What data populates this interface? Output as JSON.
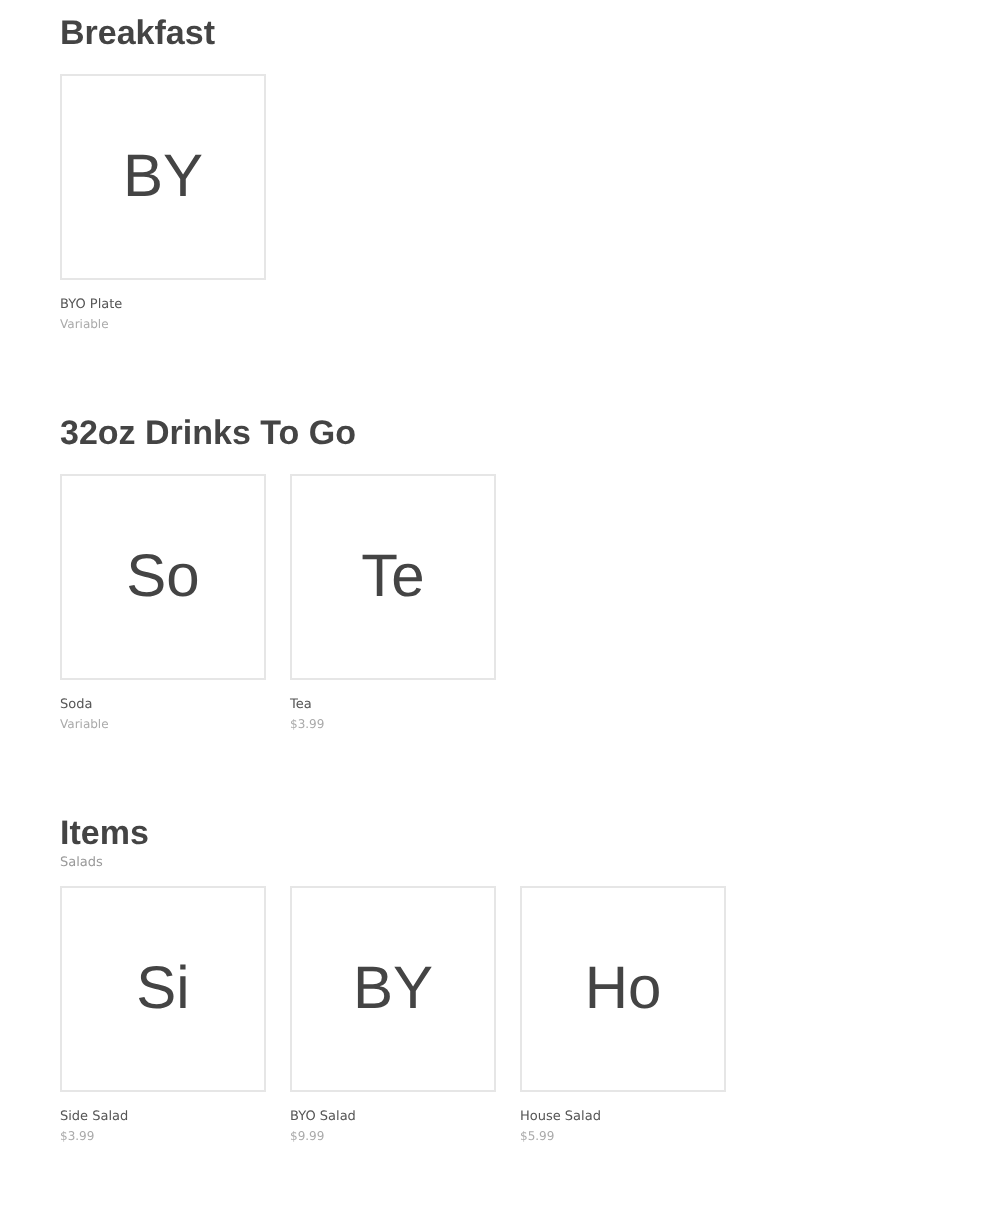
{
  "sections": [
    {
      "title": "Breakfast",
      "items": [
        {
          "initials": "BY",
          "name": "BYO Plate",
          "price": "Variable"
        }
      ]
    },
    {
      "title": "32oz Drinks To Go",
      "items": [
        {
          "initials": "So",
          "name": "Soda",
          "price": "Variable"
        },
        {
          "initials": "Te",
          "name": "Tea",
          "price": "$3.99"
        }
      ]
    },
    {
      "title": "Items",
      "subtitle": "Salads",
      "items": [
        {
          "initials": "Si",
          "name": "Side Salad",
          "price": "$3.99"
        },
        {
          "initials": "BY",
          "name": "BYO Salad",
          "price": "$9.99"
        },
        {
          "initials": "Ho",
          "name": "House Salad",
          "price": "$5.99"
        }
      ]
    }
  ]
}
